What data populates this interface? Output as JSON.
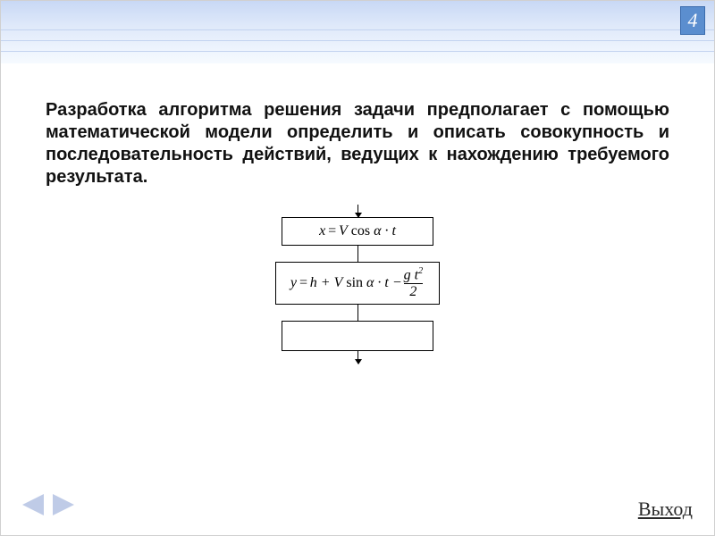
{
  "page_number": "4",
  "text": {
    "bold_lead": "Разработка алгоритма ",
    "rest": "решения задачи предполагает с помощью математической модели определить и описать совокупность и последовательность действий, ведущих к нахождению требуемого результата."
  },
  "flowchart": {
    "block1": {
      "lhs": "x",
      "eq": "=",
      "rhs": "V cos α · t"
    },
    "block2": {
      "lhs": "y",
      "eq": "=",
      "rhs_linear": "h + V sin α · t − ",
      "frac_num": "g t²",
      "frac_den": "2"
    },
    "block3": ""
  },
  "nav": {
    "prev_icon": "prev-arrow",
    "next_icon": "next-arrow",
    "exit_label": "Выход"
  }
}
